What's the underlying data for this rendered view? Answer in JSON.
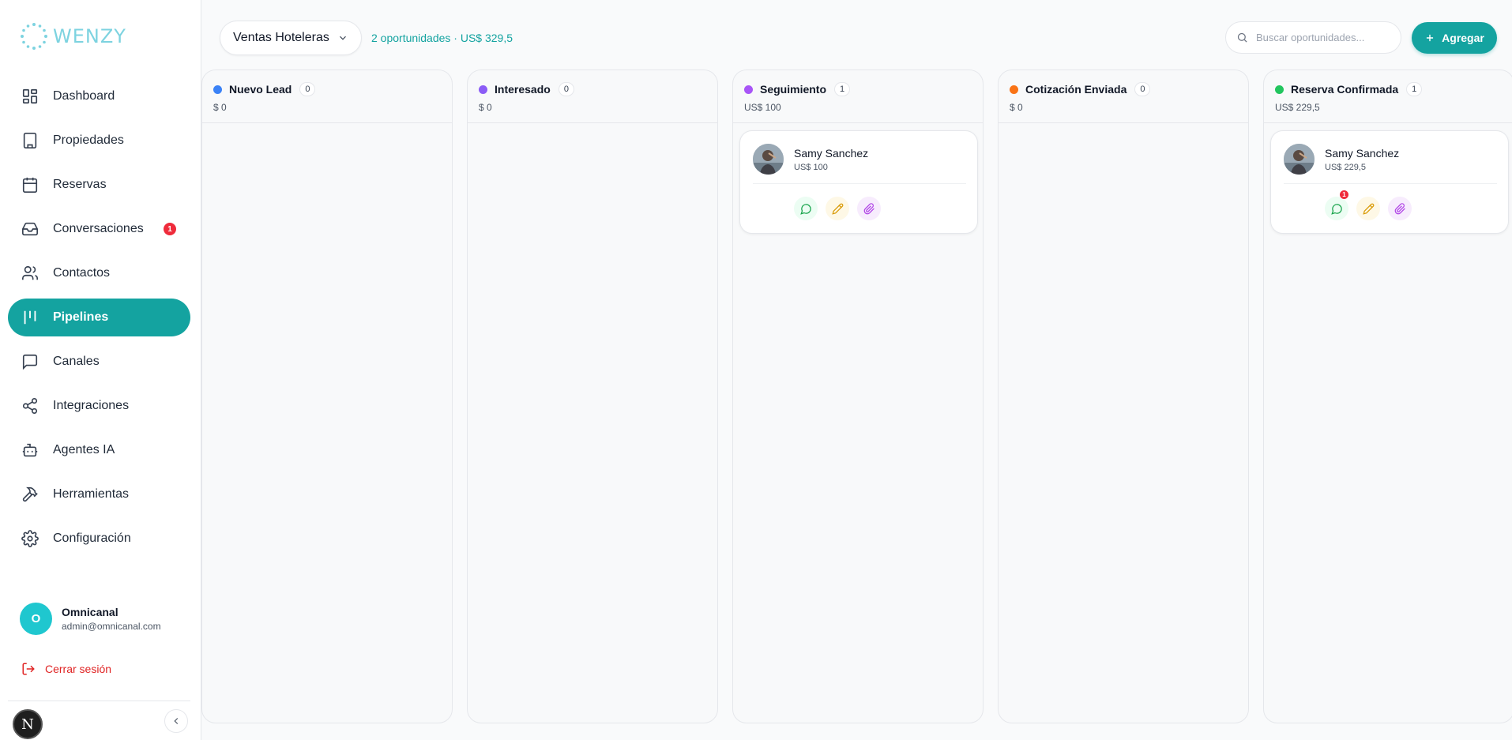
{
  "app": {
    "logo_text": "WENZY",
    "brand_color": "#14a3a0"
  },
  "sidebar": {
    "items": [
      {
        "label": "Dashboard",
        "icon": "dashboard-icon"
      },
      {
        "label": "Propiedades",
        "icon": "building-icon"
      },
      {
        "label": "Reservas",
        "icon": "calendar-icon"
      },
      {
        "label": "Conversaciones",
        "icon": "inbox-icon",
        "badge": "1"
      },
      {
        "label": "Contactos",
        "icon": "users-icon"
      },
      {
        "label": "Pipelines",
        "icon": "kanban-icon",
        "active": true
      },
      {
        "label": "Canales",
        "icon": "message-square-icon"
      },
      {
        "label": "Integraciones",
        "icon": "share-icon"
      },
      {
        "label": "Agentes IA",
        "icon": "bot-icon"
      },
      {
        "label": "Herramientas",
        "icon": "hammer-icon"
      },
      {
        "label": "Configuración",
        "icon": "gear-icon"
      }
    ],
    "user": {
      "initial": "O",
      "name": "Omnicanal",
      "email": "admin@omnicanal.com"
    },
    "logout_label": "Cerrar sesión",
    "dev_badge": "N"
  },
  "topbar": {
    "pipeline_label": "Ventas Hoteleras",
    "summary": "2 oportunidades · US$ 329,5",
    "search_placeholder": "Buscar oportunidades...",
    "add_label": "Agregar"
  },
  "columns": [
    {
      "title": "Nuevo Lead",
      "count": "0",
      "total": "$ 0",
      "color": "#3b82f6",
      "cards": []
    },
    {
      "title": "Interesado",
      "count": "0",
      "total": "$ 0",
      "color": "#8b5cf6",
      "cards": []
    },
    {
      "title": "Seguimiento",
      "count": "1",
      "total": "US$ 100",
      "color": "#a855f7",
      "cards": [
        {
          "name": "Samy Sanchez",
          "amount": "US$ 100",
          "chat_badge": ""
        }
      ]
    },
    {
      "title": "Cotización Enviada",
      "count": "0",
      "total": "$ 0",
      "color": "#f97316",
      "cards": []
    },
    {
      "title": "Reserva Confirmada",
      "count": "1",
      "total": "US$ 229,5",
      "color": "#22c55e",
      "cards": [
        {
          "name": "Samy Sanchez",
          "amount": "US$ 229,5",
          "chat_badge": "1"
        }
      ]
    }
  ]
}
